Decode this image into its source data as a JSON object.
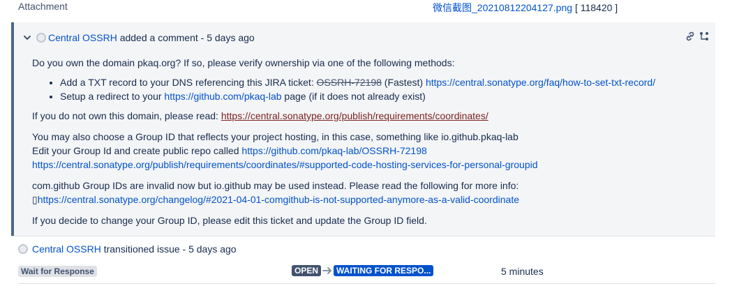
{
  "attachment": {
    "label": "Attachment",
    "file_name": "微信截图_20210812204127.png",
    "file_size": "[ 118420 ]"
  },
  "comment": {
    "author": "Central OSSRH",
    "action": "added a comment - 5 days ago",
    "intro": "Do you own the domain pkaq.org? If so, please verify ownership via one of the following methods:",
    "bullet1_text": "Add a TXT record to your DNS referencing this JIRA ticket: ",
    "bullet1_ticket": "OSSRH-72198",
    "bullet1_fastest": " (Fastest) ",
    "bullet1_link": "https://central.sonatype.org/faq/how-to-set-txt-record/",
    "bullet2_text": "Setup a redirect to your ",
    "bullet2_link": "https://github.com/pkaq-lab",
    "bullet2_suffix": " page (if it does not already exist)",
    "not_own_text": "If you do not own this domain, please read: ",
    "not_own_link": "https://central.sonatype.org/publish/requirements/coordinates/",
    "group_line1": "You may also choose a Group ID that reflects your project hosting, in this case, something like io.github.pkaq-lab",
    "group_line2_text": "Edit your Group Id and create public repo called ",
    "group_line2_link": "https://github.com/pkaq-lab/OSSRH-72198",
    "group_line3_link": "https://central.sonatype.org/publish/requirements/coordinates/#supported-code-hosting-services-for-personal-groupid",
    "comgithub_text": "com.github Group IDs are invalid now but io.github may be used instead. Please read the following for more info:",
    "comgithub_link": "https://central.sonatype.org/changelog/#2021-04-01-comgithub-is-not-supported-anymore-as-a-valid-coordinate",
    "final_text": "If you decide to change your Group ID, please edit this ticket and update the Group ID field."
  },
  "transition": {
    "author": "Central OSSRH",
    "action": "transitioned issue - 5 days ago",
    "state_label": "Wait for Response",
    "from_status": "OPEN",
    "to_status": "WAITING FOR RESPO...",
    "duration": "5 minutes"
  },
  "colors": {
    "accent_border": "#4a6785",
    "link": "#0052cc",
    "comment_bg": "#f4f5f7"
  },
  "icons": [
    "chevron-down-icon",
    "avatar-icon",
    "permalink-icon",
    "share-icon",
    "arrow-right-icon"
  ]
}
